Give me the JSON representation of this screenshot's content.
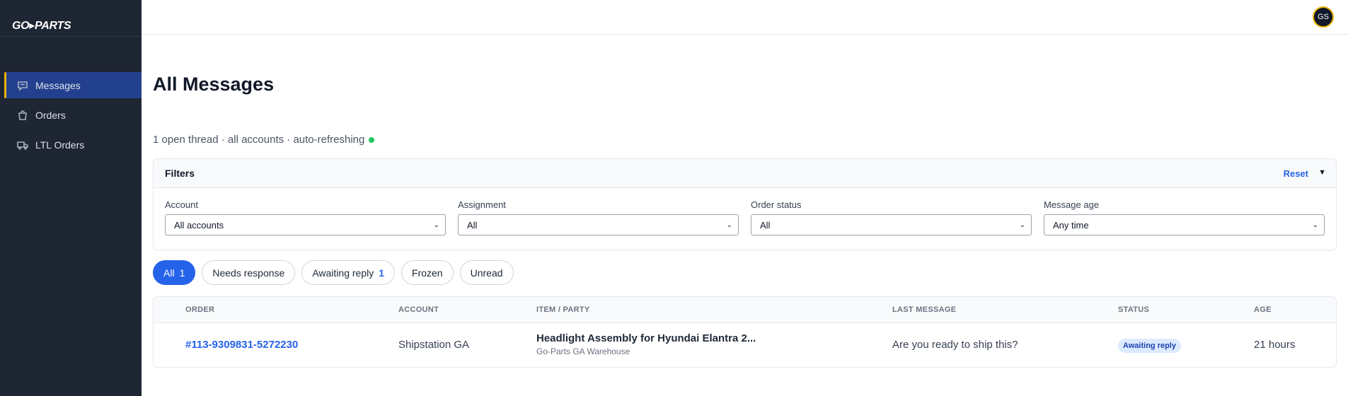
{
  "brand": {
    "logo_text": "GO▸PARTS"
  },
  "sidebar": {
    "items": [
      {
        "label": "Messages",
        "icon": "chat-icon",
        "active": true
      },
      {
        "label": "Orders",
        "icon": "bag-icon",
        "active": false
      },
      {
        "label": "LTL Orders",
        "icon": "truck-icon",
        "active": false
      }
    ]
  },
  "user": {
    "initials": "GS"
  },
  "page": {
    "title": "All Messages",
    "subtitle": "1 open thread · all accounts · auto-refreshing"
  },
  "filters": {
    "title": "Filters",
    "reset_label": "Reset",
    "fields": [
      {
        "label": "Account",
        "value": "All accounts"
      },
      {
        "label": "Assignment",
        "value": "All"
      },
      {
        "label": "Order status",
        "value": "All"
      },
      {
        "label": "Message age",
        "value": "Any time"
      }
    ]
  },
  "chips": [
    {
      "label": "All",
      "count": "1",
      "active": true
    },
    {
      "label": "Needs response",
      "count": ""
    },
    {
      "label": "Awaiting reply",
      "count": "1"
    },
    {
      "label": "Frozen",
      "count": ""
    },
    {
      "label": "Unread",
      "count": ""
    }
  ],
  "table": {
    "columns": {
      "order": "ORDER",
      "account": "ACCOUNT",
      "item": "ITEM / PARTY",
      "last_message": "LAST MESSAGE",
      "status": "STATUS",
      "age": "AGE"
    },
    "rows": [
      {
        "order": "#113-9309831-5272230",
        "account": "Shipstation GA",
        "item_title": "Headlight Assembly for Hyundai Elantra 2...",
        "item_party": "Go-Parts GA Warehouse",
        "last_message": "Are you ready to ship this?",
        "status": "Awaiting reply",
        "age": "21 hours"
      }
    ]
  },
  "colors": {
    "sidebar_bg": "#1e2533",
    "active_nav_bg": "#23408e",
    "accent_yellow": "#eab308",
    "primary_blue": "#2563eb",
    "live_green": "#22c55e"
  }
}
